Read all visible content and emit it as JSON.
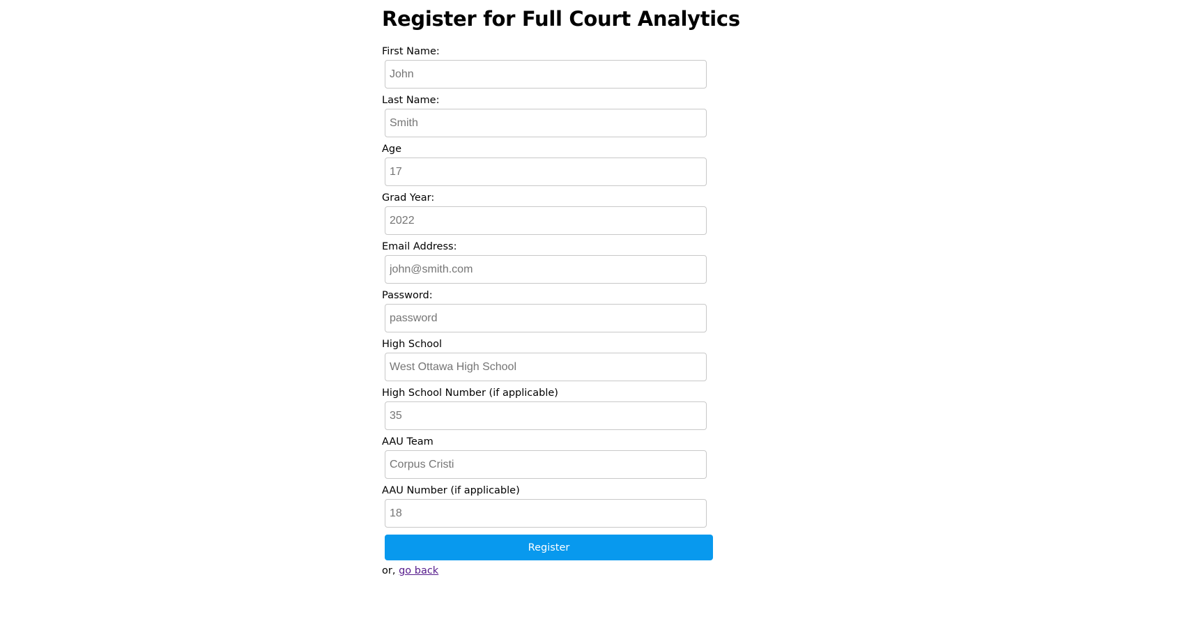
{
  "page": {
    "title": "Register for Full Court Analytics"
  },
  "fields": [
    {
      "label": "First Name:",
      "placeholder": "John",
      "value": ""
    },
    {
      "label": "Last Name:",
      "placeholder": "Smith",
      "value": ""
    },
    {
      "label": "Age",
      "placeholder": "17",
      "value": ""
    },
    {
      "label": "Grad Year:",
      "placeholder": "2022",
      "value": ""
    },
    {
      "label": "Email Address:",
      "placeholder": "john@smith.com",
      "value": ""
    },
    {
      "label": "Password:",
      "placeholder": "password",
      "value": ""
    },
    {
      "label": "High School",
      "placeholder": "West Ottawa High School",
      "value": ""
    },
    {
      "label": "High School Number (if applicable)",
      "placeholder": "35",
      "value": ""
    },
    {
      "label": "AAU Team",
      "placeholder": "Corpus Cristi",
      "value": ""
    },
    {
      "label": "AAU Number (if applicable)",
      "placeholder": "18",
      "value": ""
    }
  ],
  "actions": {
    "register_label": "Register",
    "back_prefix": "or, ",
    "back_link_label": "go back"
  },
  "colors": {
    "button_bg": "#0899ee",
    "link": "#551a8b"
  }
}
